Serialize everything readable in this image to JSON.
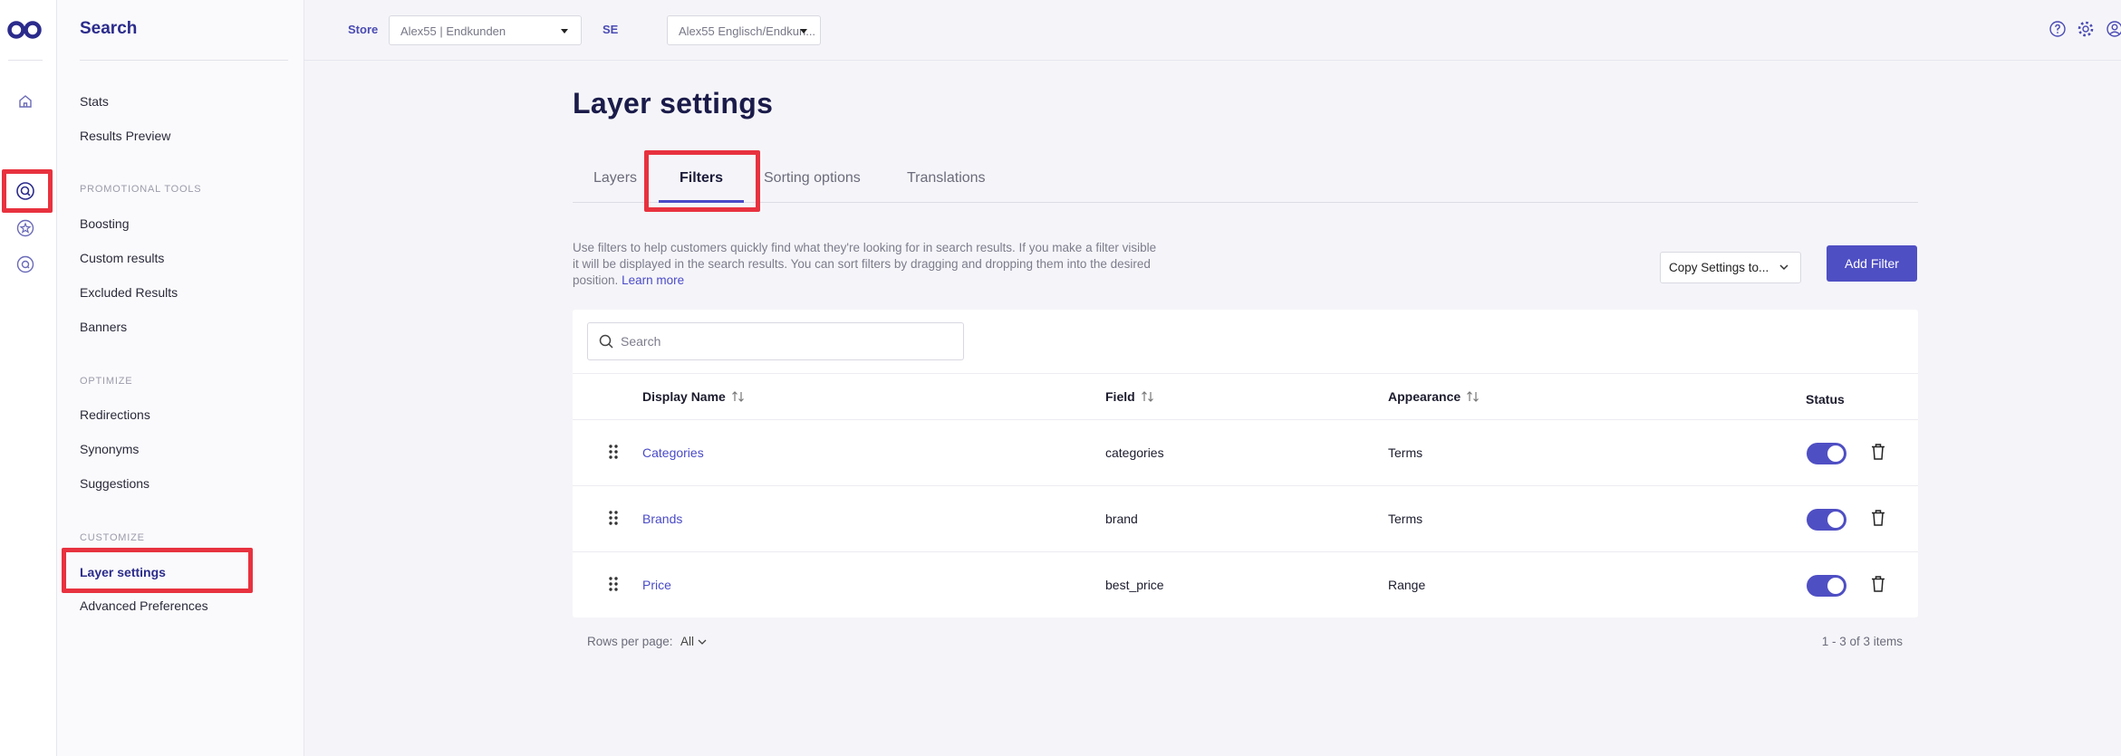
{
  "sidebar": {
    "title": "Search",
    "items_top": [
      "Stats",
      "Results Preview"
    ],
    "sections": {
      "promotional": "PROMOTIONAL TOOLS",
      "optimize": "OPTIMIZE",
      "customize": "CUSTOMIZE"
    },
    "promotional_items": [
      "Boosting",
      "Custom results",
      "Excluded Results",
      "Banners"
    ],
    "optimize_items": [
      "Redirections",
      "Synonyms",
      "Suggestions"
    ],
    "customize_items": [
      "Layer settings",
      "Advanced Preferences"
    ]
  },
  "topbar": {
    "store_label": "Store",
    "store_value": "Alex55 | Endkunden",
    "se_label": "SE",
    "se_value": "Alex55 Englisch/Endkun..."
  },
  "page": {
    "title": "Layer settings",
    "tabs": [
      "Layers",
      "Filters",
      "Sorting options",
      "Translations"
    ],
    "active_tab": "Filters",
    "description": "Use filters to help customers quickly find what they're looking for in search results. If you make a filter visible it will be displayed in the search results. You can sort filters by dragging and dropping them into the desired position.",
    "learn_more": "Learn more",
    "copy_settings": "Copy Settings to...",
    "add_filter": "Add Filter"
  },
  "table": {
    "search_placeholder": "Search",
    "columns": [
      "Display Name",
      "Field",
      "Appearance",
      "Status"
    ],
    "rows": [
      {
        "name": "Categories",
        "field": "categories",
        "appearance": "Terms",
        "enabled": true
      },
      {
        "name": "Brands",
        "field": "brand",
        "appearance": "Terms",
        "enabled": true
      },
      {
        "name": "Price",
        "field": "best_price",
        "appearance": "Range",
        "enabled": true
      }
    ],
    "rows_per_page_label": "Rows per page:",
    "rows_per_page_value": "All",
    "count": "1 - 3 of 3 items"
  },
  "colors": {
    "accent": "#4f4fc4",
    "highlight": "#e8323f",
    "title": "#1b1b4a"
  }
}
